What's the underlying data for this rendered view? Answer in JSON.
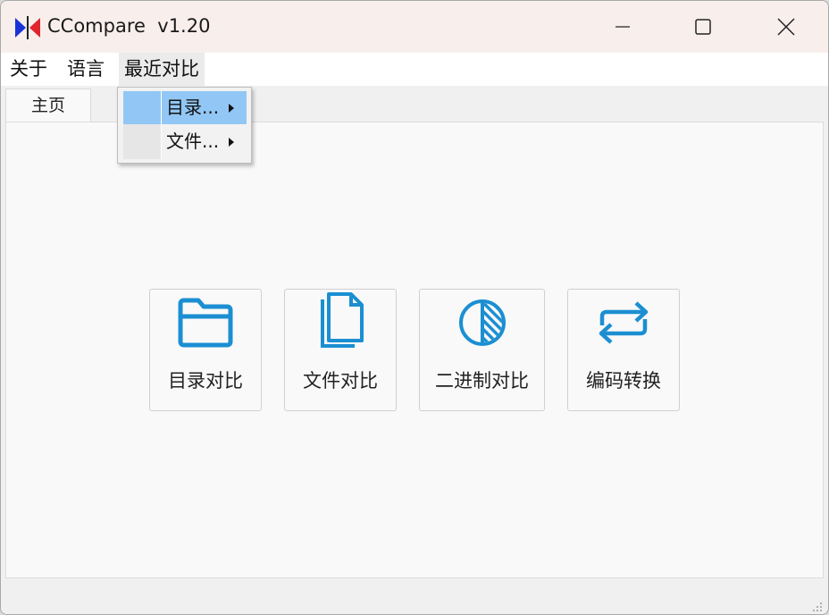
{
  "window": {
    "title": "CCompare  v1.20",
    "controls": [
      "minimize-icon",
      "maximize-icon",
      "close-icon"
    ]
  },
  "menubar": {
    "items": [
      {
        "label": "关于"
      },
      {
        "label": "语言"
      },
      {
        "label": "最近对比"
      }
    ],
    "open_menu": "最近对比",
    "dropdown": [
      {
        "label": "目录...",
        "submenu": true,
        "highlighted": true
      },
      {
        "label": "文件...",
        "submenu": true,
        "highlighted": false
      }
    ]
  },
  "tabs": [
    {
      "label": "主页",
      "selected": true
    }
  ],
  "actions": [
    {
      "label": "目录对比",
      "icon": "folder-icon"
    },
    {
      "label": "文件对比",
      "icon": "files-icon"
    },
    {
      "label": "二进制对比",
      "icon": "half-circle-icon"
    },
    {
      "label": "编码转换",
      "icon": "repeat-arrows-icon"
    }
  ],
  "colors": {
    "accent": "#1b8fd2",
    "menu_highlight": "#92c7f5",
    "titlebar": "#f8efec",
    "logo_blue": "#1a33d6",
    "logo_red": "#e0252e"
  }
}
